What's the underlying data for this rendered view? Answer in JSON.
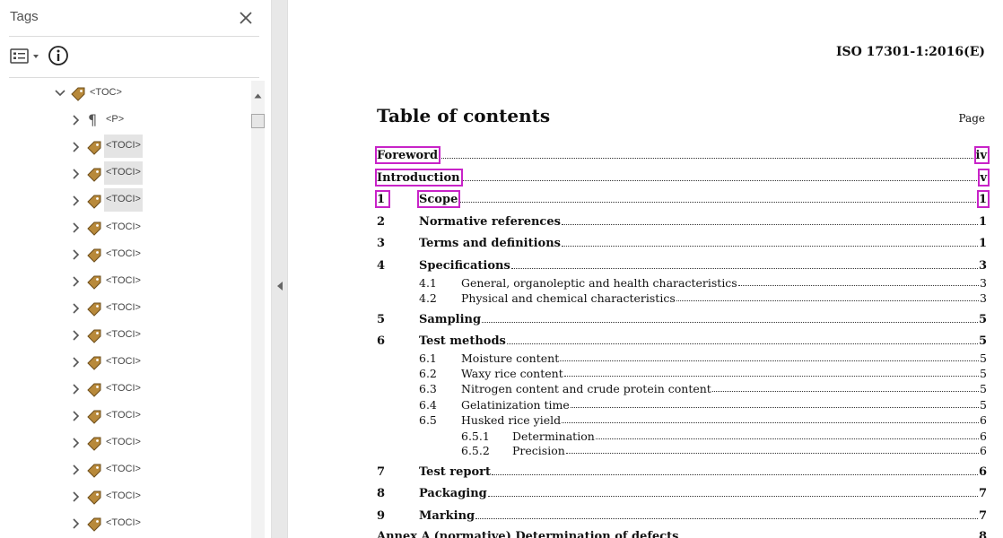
{
  "panel": {
    "title": "Tags",
    "tree": [
      {
        "label": "<TOC>",
        "icon": "tag-icon",
        "expanded": true,
        "level": 0,
        "selected": false
      },
      {
        "label": "<P>",
        "icon": "paragraph-icon",
        "expanded": false,
        "level": 1,
        "selected": false
      },
      {
        "label": "<TOCI>",
        "icon": "tag-icon",
        "expanded": false,
        "level": 1,
        "selected": true
      },
      {
        "label": "<TOCI>",
        "icon": "tag-icon",
        "expanded": false,
        "level": 1,
        "selected": true
      },
      {
        "label": "<TOCI>",
        "icon": "tag-icon",
        "expanded": false,
        "level": 1,
        "selected": true
      },
      {
        "label": "<TOCI>",
        "icon": "tag-icon",
        "expanded": false,
        "level": 1,
        "selected": false
      },
      {
        "label": "<TOCI>",
        "icon": "tag-icon",
        "expanded": false,
        "level": 1,
        "selected": false
      },
      {
        "label": "<TOCI>",
        "icon": "tag-icon",
        "expanded": false,
        "level": 1,
        "selected": false
      },
      {
        "label": "<TOCI>",
        "icon": "tag-icon",
        "expanded": false,
        "level": 1,
        "selected": false
      },
      {
        "label": "<TOCI>",
        "icon": "tag-icon",
        "expanded": false,
        "level": 1,
        "selected": false
      },
      {
        "label": "<TOCI>",
        "icon": "tag-icon",
        "expanded": false,
        "level": 1,
        "selected": false
      },
      {
        "label": "<TOCI>",
        "icon": "tag-icon",
        "expanded": false,
        "level": 1,
        "selected": false
      },
      {
        "label": "<TOCI>",
        "icon": "tag-icon",
        "expanded": false,
        "level": 1,
        "selected": false
      },
      {
        "label": "<TOCI>",
        "icon": "tag-icon",
        "expanded": false,
        "level": 1,
        "selected": false
      },
      {
        "label": "<TOCI>",
        "icon": "tag-icon",
        "expanded": false,
        "level": 1,
        "selected": false
      },
      {
        "label": "<TOCI>",
        "icon": "tag-icon",
        "expanded": false,
        "level": 1,
        "selected": false
      },
      {
        "label": "<TOCI>",
        "icon": "tag-icon",
        "expanded": false,
        "level": 1,
        "selected": false
      }
    ]
  },
  "document": {
    "header": "ISO 17301-1:2016(E)",
    "heading": "Table of contents",
    "page_column_label": "Page",
    "entries": [
      {
        "num": "",
        "title": "Foreword",
        "page": "iv",
        "level": 1,
        "highlighted": true
      },
      {
        "num": "",
        "title": "Introduction",
        "page": "v",
        "level": 1,
        "highlighted": true
      },
      {
        "num": "1",
        "title": "Scope",
        "page": "1",
        "level": 1,
        "highlighted": true
      },
      {
        "num": "2",
        "title": "Normative references",
        "page": "1",
        "level": 1
      },
      {
        "num": "3",
        "title": "Terms and definitions",
        "page": "1",
        "level": 1
      },
      {
        "num": "4",
        "title": "Specifications",
        "page": "3",
        "level": 1
      },
      {
        "num": "4.1",
        "title": "General, organoleptic and health characteristics",
        "page": "3",
        "level": 2
      },
      {
        "num": "4.2",
        "title": "Physical and chemical characteristics",
        "page": "3",
        "level": 2
      },
      {
        "num": "5",
        "title": "Sampling",
        "page": "5",
        "level": 1
      },
      {
        "num": "6",
        "title": "Test methods",
        "page": "5",
        "level": 1
      },
      {
        "num": "6.1",
        "title": "Moisture content",
        "page": "5",
        "level": 2
      },
      {
        "num": "6.2",
        "title": "Waxy rice content",
        "page": "5",
        "level": 2
      },
      {
        "num": "6.3",
        "title": "Nitrogen content and crude protein content",
        "page": "5",
        "level": 2
      },
      {
        "num": "6.4",
        "title": "Gelatinization time",
        "page": "5",
        "level": 2
      },
      {
        "num": "6.5",
        "title": "Husked rice yield",
        "page": "6",
        "level": 2
      },
      {
        "num": "6.5.1",
        "title": "Determination",
        "page": "6",
        "level": 3
      },
      {
        "num": "6.5.2",
        "title": "Precision",
        "page": "6",
        "level": 3
      },
      {
        "num": "7",
        "title": "Test report",
        "page": "6",
        "level": 1
      },
      {
        "num": "8",
        "title": "Packaging",
        "page": "7",
        "level": 1
      },
      {
        "num": "9",
        "title": "Marking",
        "page": "7",
        "level": 1
      },
      {
        "num": "Annex A",
        "title": "(normative) Determination of defects",
        "page": "8",
        "level": 1
      }
    ]
  },
  "colors": {
    "highlight": "#c823c8",
    "tag_icon": "#b8893a",
    "selection": "#e4e4e4"
  }
}
